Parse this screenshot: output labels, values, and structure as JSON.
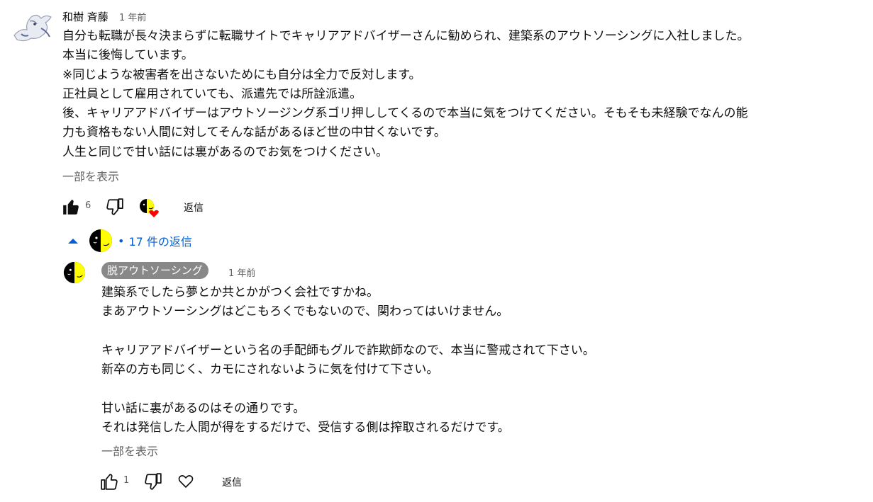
{
  "comment": {
    "author": "和樹 斉藤",
    "time": "1 年前",
    "text": "自分も転職が長々決まらずに転職サイトでキャリアアドバイザーさんに勧められ、建築系のアウトソーシングに入社しました。\n本当に後悔しています。\n※同じような被害者を出さないためにも自分は全力で反対します。\n正社員として雇用されていても、派遣先では所詮派遣。\n後、キャリアアドバイザーはアウトソージング系ゴリ押ししてくるので本当に気をつけてください。そもそも未経験でなんの能\n力も資格もない人間に対してそんな話があるほど世の中甘くないです。\n人生と同じで甘い話には裏があるのでお気をつけください。",
    "show_more": "一部を表示",
    "like_count": "6",
    "reply_label": "返信"
  },
  "replies_toggle": {
    "bullet": "•",
    "label": "17 件の返信"
  },
  "reply": {
    "author": "脱アウトソーシング",
    "time": "1 年前",
    "text": "建築系でしたら夢とか共とかがつく会社ですかね。\nまあアウトソーシングはどこもろくでもないので、関わってはいけません。\n\nキャリアアドバイザーという名の手配師もグルで詐欺師なので、本当に警戒されて下さい。\n新卒の方も同じく、カモにされないように気を付けて下さい。\n\n甘い話に裏があるのはその通りです。\nそれは発信した人間が得をするだけで、受信する側は搾取されるだけです。",
    "show_more": "一部を表示",
    "like_count": "1",
    "reply_label": "返信"
  },
  "colors": {
    "link_blue": "#065fd4",
    "owner_badge": "#888888",
    "heart_red": "#ff0000",
    "face_yellow": "#ffff00"
  },
  "icons": [
    "bird-avatar-icon",
    "like-filled-icon",
    "dislike-icon",
    "creator-heart-icon",
    "collapse-arrow-icon",
    "face-avatar-icon",
    "like-outline-icon",
    "heart-outline-icon"
  ]
}
